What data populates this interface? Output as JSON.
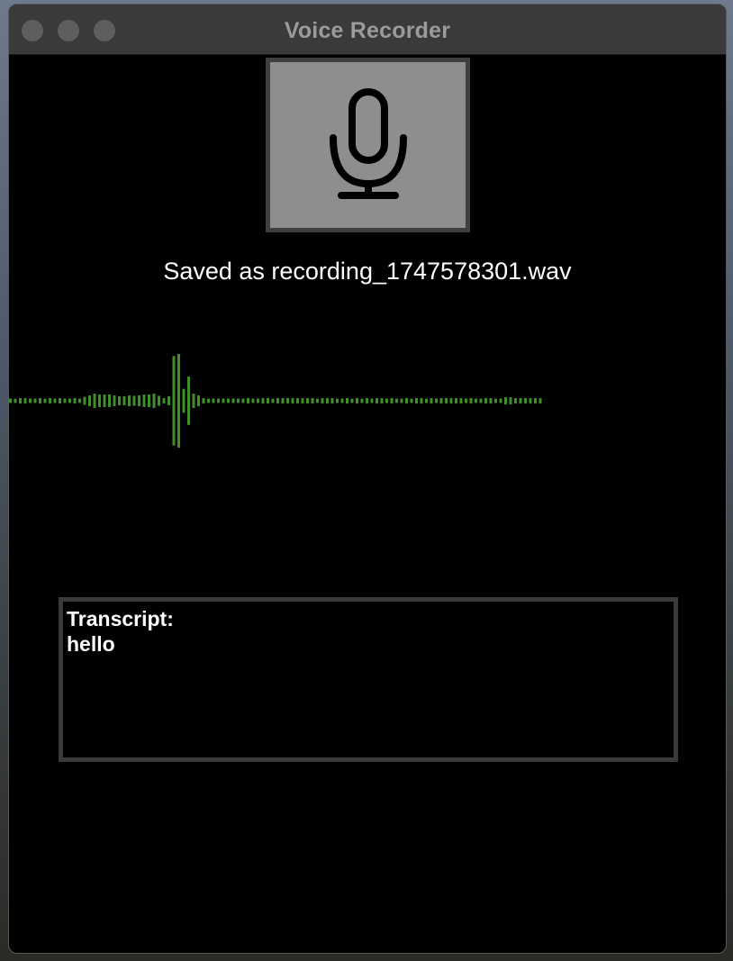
{
  "window": {
    "title": "Voice Recorder"
  },
  "recorder": {
    "mic_button_icon": "microphone-icon",
    "status": "Saved as recording_1747578301.wav"
  },
  "waveform": {
    "color": "#3f8f2a",
    "amplitudes": [
      0.022,
      0.022,
      0.027,
      0.027,
      0.022,
      0.022,
      0.027,
      0.022,
      0.027,
      0.022,
      0.027,
      0.022,
      0.022,
      0.027,
      0.022,
      0.04,
      0.054,
      0.072,
      0.063,
      0.063,
      0.063,
      0.054,
      0.045,
      0.045,
      0.054,
      0.05,
      0.054,
      0.063,
      0.063,
      0.072,
      0.05,
      0.027,
      0.045,
      0.452,
      0.473,
      0.121,
      0.244,
      0.072,
      0.054,
      0.027,
      0.022,
      0.022,
      0.022,
      0.022,
      0.022,
      0.022,
      0.022,
      0.022,
      0.027,
      0.022,
      0.022,
      0.027,
      0.027,
      0.022,
      0.027,
      0.027,
      0.027,
      0.027,
      0.027,
      0.027,
      0.027,
      0.027,
      0.022,
      0.027,
      0.027,
      0.027,
      0.022,
      0.022,
      0.027,
      0.022,
      0.027,
      0.022,
      0.027,
      0.022,
      0.027,
      0.027,
      0.022,
      0.027,
      0.022,
      0.022,
      0.027,
      0.022,
      0.027,
      0.027,
      0.022,
      0.027,
      0.022,
      0.027,
      0.027,
      0.027,
      0.027,
      0.027,
      0.022,
      0.027,
      0.022,
      0.022,
      0.027,
      0.027,
      0.022,
      0.022,
      0.036,
      0.036,
      0.027,
      0.027,
      0.027,
      0.027,
      0.027,
      0.027
    ]
  },
  "transcript": {
    "label": "Transcript:",
    "text": "hello"
  }
}
